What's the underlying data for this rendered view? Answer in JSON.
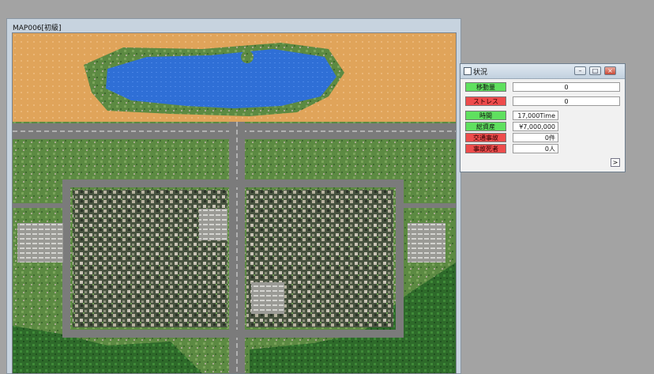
{
  "map_window": {
    "title": "MAP006[初級]"
  },
  "status_window": {
    "title": "状況",
    "minimize_icon": "minimize-icon",
    "maximize_icon": "maximize-icon",
    "close_icon": "close-icon",
    "rows": [
      {
        "label": "移動量",
        "value": "0",
        "color": "green"
      },
      {
        "label": "ストレス",
        "value": "0",
        "color": "red"
      },
      {
        "label": "時間",
        "value": "17,000Time",
        "color": "green"
      },
      {
        "label": "総資産",
        "value": "¥7,000,000",
        "color": "green"
      },
      {
        "label": "交通事故",
        "value": "0件",
        "color": "red"
      },
      {
        "label": "事故死者",
        "value": "0人",
        "color": "red"
      }
    ],
    "expand_label": ">"
  },
  "colors": {
    "label_green": "#5fe05f",
    "label_red": "#ee4c4c",
    "water": "#2f6fd6",
    "sand": "#e2a85c",
    "grass": "#5f8f45",
    "road": "#7b7b7b",
    "city": "#3e4a3a"
  }
}
